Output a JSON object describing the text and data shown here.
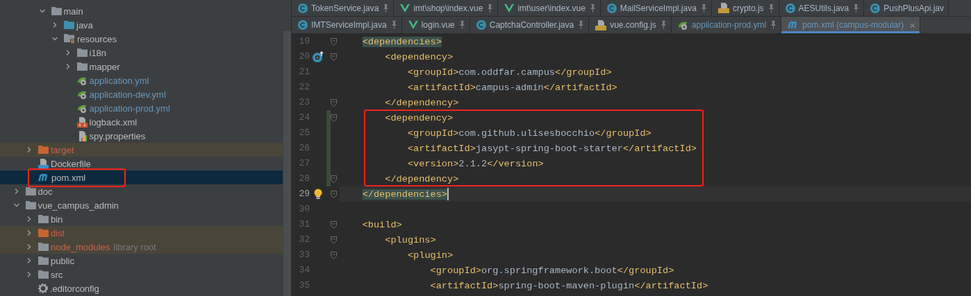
{
  "tree": {
    "items": [
      {
        "children": [
          {
            "children": [
              {
                "label": "main",
                "kind": "folder",
                "expanded": true,
                "selected": false,
                "excluded": false,
                "annotated": false,
                "children": [
                  {
                    "label": "java",
                    "kind": "source-folder",
                    "expanded": false,
                    "selected": false,
                    "excluded": false,
                    "annotated": false
                  },
                  {
                    "label": "resources",
                    "kind": "resources-folder",
                    "expanded": true,
                    "selected": false,
                    "excluded": false,
                    "annotated": false,
                    "children": [
                      {
                        "label": "i18n",
                        "kind": "folder",
                        "expanded": false,
                        "selected": false,
                        "excluded": false,
                        "annotated": false
                      },
                      {
                        "label": "mapper",
                        "kind": "folder",
                        "expanded": false,
                        "selected": false,
                        "excluded": false,
                        "annotated": false
                      },
                      {
                        "label": "application.yml",
                        "kind": "yml",
                        "selected": false,
                        "excluded": false,
                        "annotated": false,
                        "color": "#6897bb"
                      },
                      {
                        "label": "application-dev.yml",
                        "kind": "yml",
                        "selected": false,
                        "excluded": false,
                        "annotated": false,
                        "color": "#6897bb"
                      },
                      {
                        "label": "application-prod.yml",
                        "kind": "yml",
                        "selected": false,
                        "excluded": false,
                        "annotated": false,
                        "color": "#6897bb"
                      },
                      {
                        "label": "logback.xml",
                        "kind": "xml",
                        "selected": false,
                        "excluded": false,
                        "annotated": false
                      },
                      {
                        "label": "spy.properties",
                        "kind": "properties",
                        "selected": false,
                        "excluded": false,
                        "annotated": false
                      }
                    ]
                  }
                ]
              }
            ]
          },
          {
            "label": "target",
            "kind": "excluded-folder",
            "expanded": false,
            "selected": false,
            "excluded": true,
            "annotated": false,
            "color": "#c7604c"
          },
          {
            "label": "Dockerfile",
            "kind": "docker",
            "selected": false,
            "excluded": false,
            "annotated": false
          },
          {
            "label": "pom.xml",
            "kind": "maven",
            "selected": true,
            "excluded": false,
            "annotated": true
          }
        ]
      },
      {
        "label": "doc",
        "kind": "folder",
        "expanded": false,
        "selected": false,
        "excluded": false,
        "annotated": false
      },
      {
        "label": "vue_campus_admin",
        "kind": "folder",
        "expanded": true,
        "selected": false,
        "excluded": false,
        "annotated": false,
        "children": [
          {
            "label": "bin",
            "kind": "folder",
            "expanded": false,
            "selected": false,
            "excluded": false,
            "annotated": false
          },
          {
            "label": "dist",
            "kind": "excluded-folder",
            "expanded": false,
            "selected": false,
            "excluded": true,
            "annotated": false,
            "color": "#c7604c"
          },
          {
            "label": "node_modules",
            "note": "library root",
            "kind": "folder",
            "expanded": false,
            "selected": false,
            "excluded": true,
            "annotated": false,
            "color": "#c7604c"
          },
          {
            "label": "public",
            "kind": "folder",
            "expanded": false,
            "selected": false,
            "excluded": false,
            "annotated": false
          },
          {
            "label": "src",
            "kind": "folder",
            "expanded": false,
            "selected": false,
            "excluded": false,
            "annotated": false
          },
          {
            "label": ".editorconfig",
            "kind": "gear",
            "selected": false,
            "excluded": false,
            "annotated": false
          }
        ]
      }
    ]
  },
  "tabs": [
    [
      {
        "label": "TokenService.java",
        "kind": "class",
        "pinned": true,
        "selected": false
      },
      {
        "label": "imt\\shop\\index.vue",
        "kind": "vue",
        "pinned": true,
        "selected": false
      },
      {
        "label": "imt\\user\\index.vue",
        "kind": "vue",
        "pinned": true,
        "selected": false
      },
      {
        "label": "MailServiceImpl.java",
        "kind": "class",
        "pinned": true,
        "selected": false
      },
      {
        "label": "crypto.js",
        "kind": "js",
        "pinned": true,
        "selected": false
      },
      {
        "label": "AESUtils.java",
        "kind": "class",
        "pinned": true,
        "selected": false
      },
      {
        "label": "PushPlusApi.jav",
        "kind": "class",
        "pinned": false,
        "selected": false
      }
    ],
    [
      {
        "label": "IMTServiceImpl.java",
        "kind": "class",
        "pinned": true,
        "selected": false
      },
      {
        "label": "login.vue",
        "kind": "vue",
        "pinned": true,
        "selected": false
      },
      {
        "label": "CaptchaController.java",
        "kind": "class",
        "pinned": true,
        "selected": false
      },
      {
        "label": "vue.config.js",
        "kind": "js",
        "pinned": true,
        "selected": false
      },
      {
        "label": "application-prod.yml",
        "kind": "yml",
        "pinned": true,
        "selected": false,
        "color": "#6897bb"
      },
      {
        "label": "pom.xml (campus-modular)",
        "kind": "maven",
        "pinned": false,
        "selected": true,
        "close": "×",
        "color": "#6897bb"
      }
    ]
  ],
  "editor": {
    "lines": [
      {
        "number": "19",
        "text": "    <dependencies>",
        "fold": true,
        "matched": true,
        "current": false,
        "changed": false,
        "annotated": false
      },
      {
        "number": "20",
        "text": "        <dependency>",
        "fold": true,
        "matched": false,
        "current": false,
        "changed": false,
        "annotated": false,
        "marker": {
          "kind": "override"
        }
      },
      {
        "number": "21",
        "text": "            <groupId>com.oddfar.campus</groupId>",
        "fold": false,
        "matched": false,
        "current": false,
        "changed": false,
        "annotated": false
      },
      {
        "number": "22",
        "text": "            <artifactId>campus-admin</artifactId>",
        "fold": false,
        "matched": false,
        "current": false,
        "changed": false,
        "annotated": false
      },
      {
        "number": "23",
        "text": "        </dependency>",
        "fold": true,
        "matched": false,
        "current": false,
        "changed": false,
        "annotated": false
      },
      {
        "number": "24",
        "text": "        <dependency>",
        "fold": true,
        "matched": false,
        "current": false,
        "changed": true,
        "annotated": true
      },
      {
        "number": "25",
        "text": "            <groupId>com.github.ulisesbocchio</groupId>",
        "fold": false,
        "matched": false,
        "current": false,
        "changed": true,
        "annotated": true
      },
      {
        "number": "26",
        "text": "            <artifactId>jasypt-spring-boot-starter</artifactId>",
        "fold": false,
        "matched": false,
        "current": false,
        "changed": true,
        "annotated": true
      },
      {
        "number": "27",
        "text": "            <version>2.1.2</version>",
        "fold": false,
        "matched": false,
        "current": false,
        "changed": true,
        "annotated": true
      },
      {
        "number": "28",
        "text": "        </dependency>",
        "fold": true,
        "matched": false,
        "current": false,
        "changed": true,
        "annotated": true
      },
      {
        "number": "29",
        "text": "    </dependencies>",
        "fold": true,
        "matched": true,
        "current": true,
        "changed": false,
        "annotated": false,
        "marker": {
          "kind": "bulb"
        }
      },
      {
        "number": "30",
        "fold": false,
        "matched": false,
        "current": false,
        "changed": false,
        "annotated": false
      },
      {
        "number": "31",
        "text": "    <build>",
        "fold": true,
        "matched": false,
        "current": false,
        "changed": false,
        "annotated": false
      },
      {
        "number": "32",
        "text": "        <plugins>",
        "fold": true,
        "matched": false,
        "current": false,
        "changed": false,
        "annotated": false
      },
      {
        "number": "33",
        "text": "            <plugin>",
        "fold": true,
        "matched": false,
        "current": false,
        "changed": false,
        "annotated": false
      },
      {
        "number": "34",
        "text": "                <groupId>org.springframework.boot</groupId>",
        "fold": false,
        "matched": false,
        "current": false,
        "changed": false,
        "annotated": false
      },
      {
        "number": "35",
        "text": "                <artifactId>spring-boot-maven-plugin</artifactId>",
        "fold": false,
        "matched": false,
        "current": false,
        "changed": false,
        "annotated": false
      }
    ]
  }
}
